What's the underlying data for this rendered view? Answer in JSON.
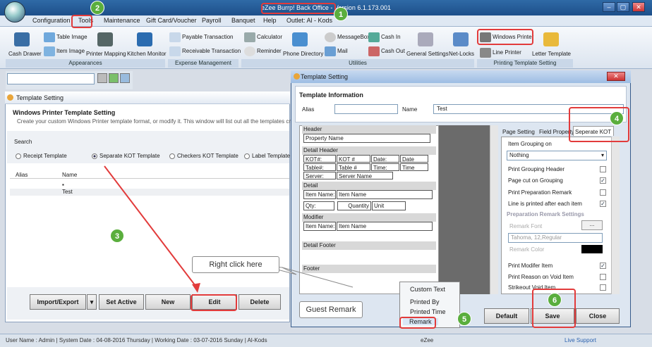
{
  "window": {
    "title": "eZee Burrp! Back Office - Version 6.1.173.001"
  },
  "menu": [
    "Configuration",
    "Tools",
    "Maintenance",
    "Gift Card/Voucher",
    "Payroll",
    "Banquet",
    "Help",
    "Outlet: Al - Kods"
  ],
  "ribbon": {
    "appearances": {
      "label": "Appearances",
      "items": [
        "Table Image",
        "Item Image",
        "Cash Drawer",
        "Printer Mapping",
        "Kitchen Monitor"
      ]
    },
    "expense": {
      "label": "Expense Management",
      "items": [
        "Payable Transaction",
        "Receivable Transaction"
      ]
    },
    "utilities": {
      "label": "Utilities",
      "items": [
        "Calculator",
        "Reminder",
        "Phone Directory",
        "MessageBox",
        "Mail",
        "Cash In",
        "Cash Out",
        "General Settings",
        "Net-Locks"
      ]
    },
    "printing": {
      "label": "Printing Template Setting",
      "items": [
        "Windows Printer",
        "Line Printer",
        "Letter Template"
      ]
    }
  },
  "left": {
    "tab_title": "Template Setting",
    "heading": "Windows Printer Template Setting",
    "desc": "Create your custom Windows Printer template format, or modify it. This window will list out all the templates created.",
    "search_label": "Search",
    "radios": [
      "Receipt Template",
      "Separate KOT Template",
      "Checkers KOT Template",
      "Label Template"
    ],
    "columns": [
      "Alias",
      "Name"
    ],
    "rows": [
      "Test"
    ],
    "buttons": [
      "Import/Export",
      "Set Active",
      "New",
      "Edit",
      "Delete"
    ]
  },
  "dialog": {
    "title": "Template Setting",
    "info_label": "Template Information",
    "alias_label": "Alias",
    "name_label": "Name",
    "name_value": "Test",
    "sections": {
      "header": "Header",
      "property": "Property Name",
      "detail_header": "Detail Header",
      "cells": [
        "KOT#:",
        "KOT #",
        "Date:",
        "Date",
        "Table#:",
        "Table #",
        "Time:",
        "Time",
        "Server:",
        "Server Name"
      ],
      "detail": "Detail",
      "item_name_l": "Item Name:",
      "item_name_v": "Item Name",
      "qty_l": "Qty:",
      "qty_v": "Quantity",
      "unit": "Unit",
      "modifier": "Modifier",
      "mod_l": "Item Name:",
      "mod_v": "Item Name",
      "detail_footer": "Detail Footer",
      "footer": "Footer"
    },
    "tabs": [
      "Page Setting",
      "Field Property",
      "Seperate KOT"
    ],
    "grouping_label": "Item Grouping on",
    "grouping_value": "Nothing",
    "options": [
      {
        "label": "Print Grouping Header",
        "checked": false
      },
      {
        "label": "Page cut on Grouping",
        "checked": true
      },
      {
        "label": "Print Preparation Remark",
        "checked": false
      },
      {
        "label": "Line is printed after each item",
        "checked": true
      }
    ],
    "remark_settings": "Preparation Remark Settings",
    "remark_font_label": "Remark Font",
    "remark_font_value": "Tahoma, 12,Regular",
    "remark_color_label": "Remark Color",
    "options2": [
      {
        "label": "Print Modifer Item",
        "checked": true
      },
      {
        "label": "Print Reason on Void Item",
        "checked": false
      },
      {
        "label": "Strikeout Void Item",
        "checked": false
      }
    ],
    "buttons": {
      "default": "Default",
      "save": "Save",
      "close": "Close"
    }
  },
  "context_menu": [
    "Custom Text",
    "Printed By",
    "Printed Time",
    "Remark"
  ],
  "callouts": {
    "right_click": "Right click here",
    "guest_remark": "Guest Remark"
  },
  "badges": [
    "1",
    "2",
    "3",
    "4",
    "5",
    "6"
  ],
  "status": "User Name : Admin  |  System Date : 04-08-2016 Thursday  |  Working Date : 03-07-2016 Sunday  |  Al-Kods",
  "status_mid": "eZee",
  "status_right": "Live Support"
}
